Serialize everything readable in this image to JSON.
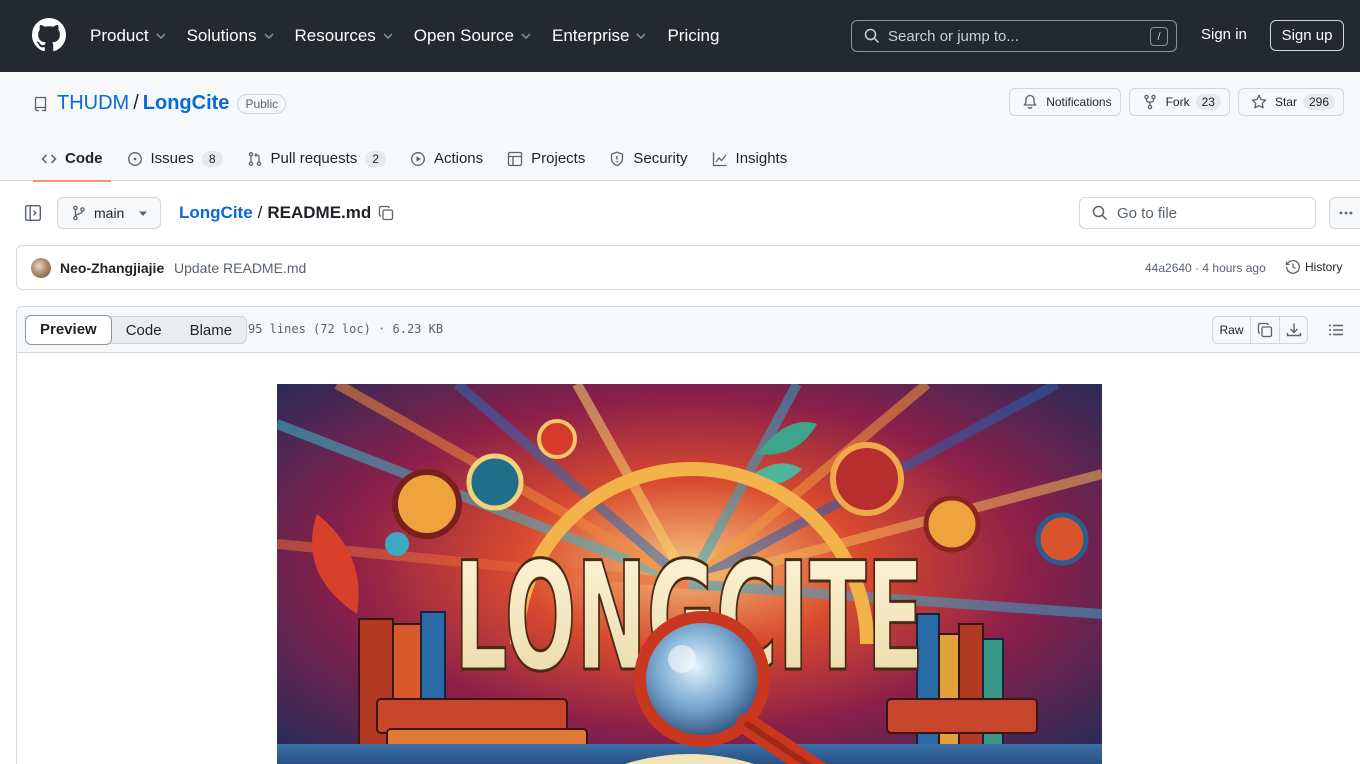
{
  "header": {
    "nav": [
      "Product",
      "Solutions",
      "Resources",
      "Open Source",
      "Enterprise",
      "Pricing"
    ],
    "search_placeholder": "Search or jump to...",
    "search_key": "/",
    "sign_in": "Sign in",
    "sign_up": "Sign up"
  },
  "repo": {
    "owner": "THUDM",
    "separator": "/",
    "name": "LongCite",
    "visibility": "Public",
    "notifications_label": "Notifications",
    "fork_label": "Fork",
    "fork_count": "23",
    "star_label": "Star",
    "star_count": "296"
  },
  "tabs": [
    {
      "label": "Code",
      "count": ""
    },
    {
      "label": "Issues",
      "count": "8"
    },
    {
      "label": "Pull requests",
      "count": "2"
    },
    {
      "label": "Actions",
      "count": ""
    },
    {
      "label": "Projects",
      "count": ""
    },
    {
      "label": "Security",
      "count": ""
    },
    {
      "label": "Insights",
      "count": ""
    }
  ],
  "file_nav": {
    "branch": "main",
    "root": "LongCite",
    "separator": "/",
    "file": "README.md",
    "goto_placeholder": "Go to file"
  },
  "commit": {
    "author": "Neo-Zhangjiajie",
    "message": "Update README.md",
    "sha": "44a2640",
    "time": "· 4 hours ago",
    "history_label": "History"
  },
  "file_view": {
    "modes": [
      "Preview",
      "Code",
      "Blame"
    ],
    "active_mode": "Preview",
    "info": "95 lines (72 loc) · 6.23 KB",
    "raw_label": "Raw"
  },
  "banner": {
    "title_text": "LONGCITE"
  },
  "colors": {
    "header_bg": "#24292f",
    "link": "#0969da",
    "active_tab_underline": "#fd8c73",
    "border": "#d0d7de"
  }
}
